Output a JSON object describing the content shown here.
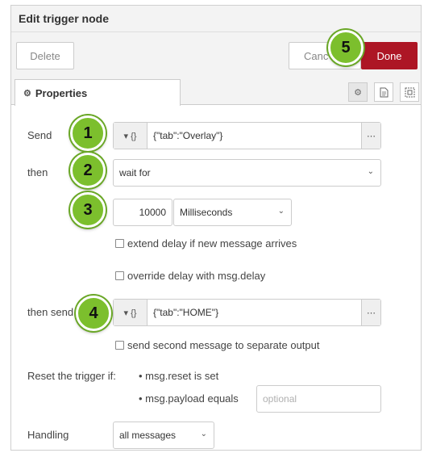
{
  "dialog": {
    "title": "Edit trigger node",
    "delete_label": "Delete",
    "cancel_label": "Canc",
    "done_label": "Done"
  },
  "tabs": {
    "properties_label": "Properties"
  },
  "form": {
    "send_label": "Send",
    "send_value": "{\"tab\":\"Overlay\"}",
    "then_label": "then",
    "then_value": "wait for",
    "delay_value": "10000",
    "delay_units": "Milliseconds",
    "extend_label": "extend delay if new message arrives",
    "override_label": "override delay with msg.delay",
    "then_send_label": "then send",
    "then_send_value": "{\"tab\":\"HOME\"}",
    "second_output_label": "send second message to separate output",
    "reset_label": "Reset the trigger if:",
    "reset_option_1": "msg.reset is set",
    "reset_option_2": "msg.payload equals",
    "reset_placeholder": "optional",
    "handling_label": "Handling",
    "handling_value": "all messages"
  },
  "badges": [
    "1",
    "2",
    "3",
    "4",
    "5"
  ],
  "colors": {
    "badge": "#7cbf2d",
    "done_button": "#ad1625"
  },
  "icons": {
    "type_selector": "json-braces-icon",
    "expand": "ellipsis-icon",
    "dropdown": "chevron-down-icon"
  }
}
